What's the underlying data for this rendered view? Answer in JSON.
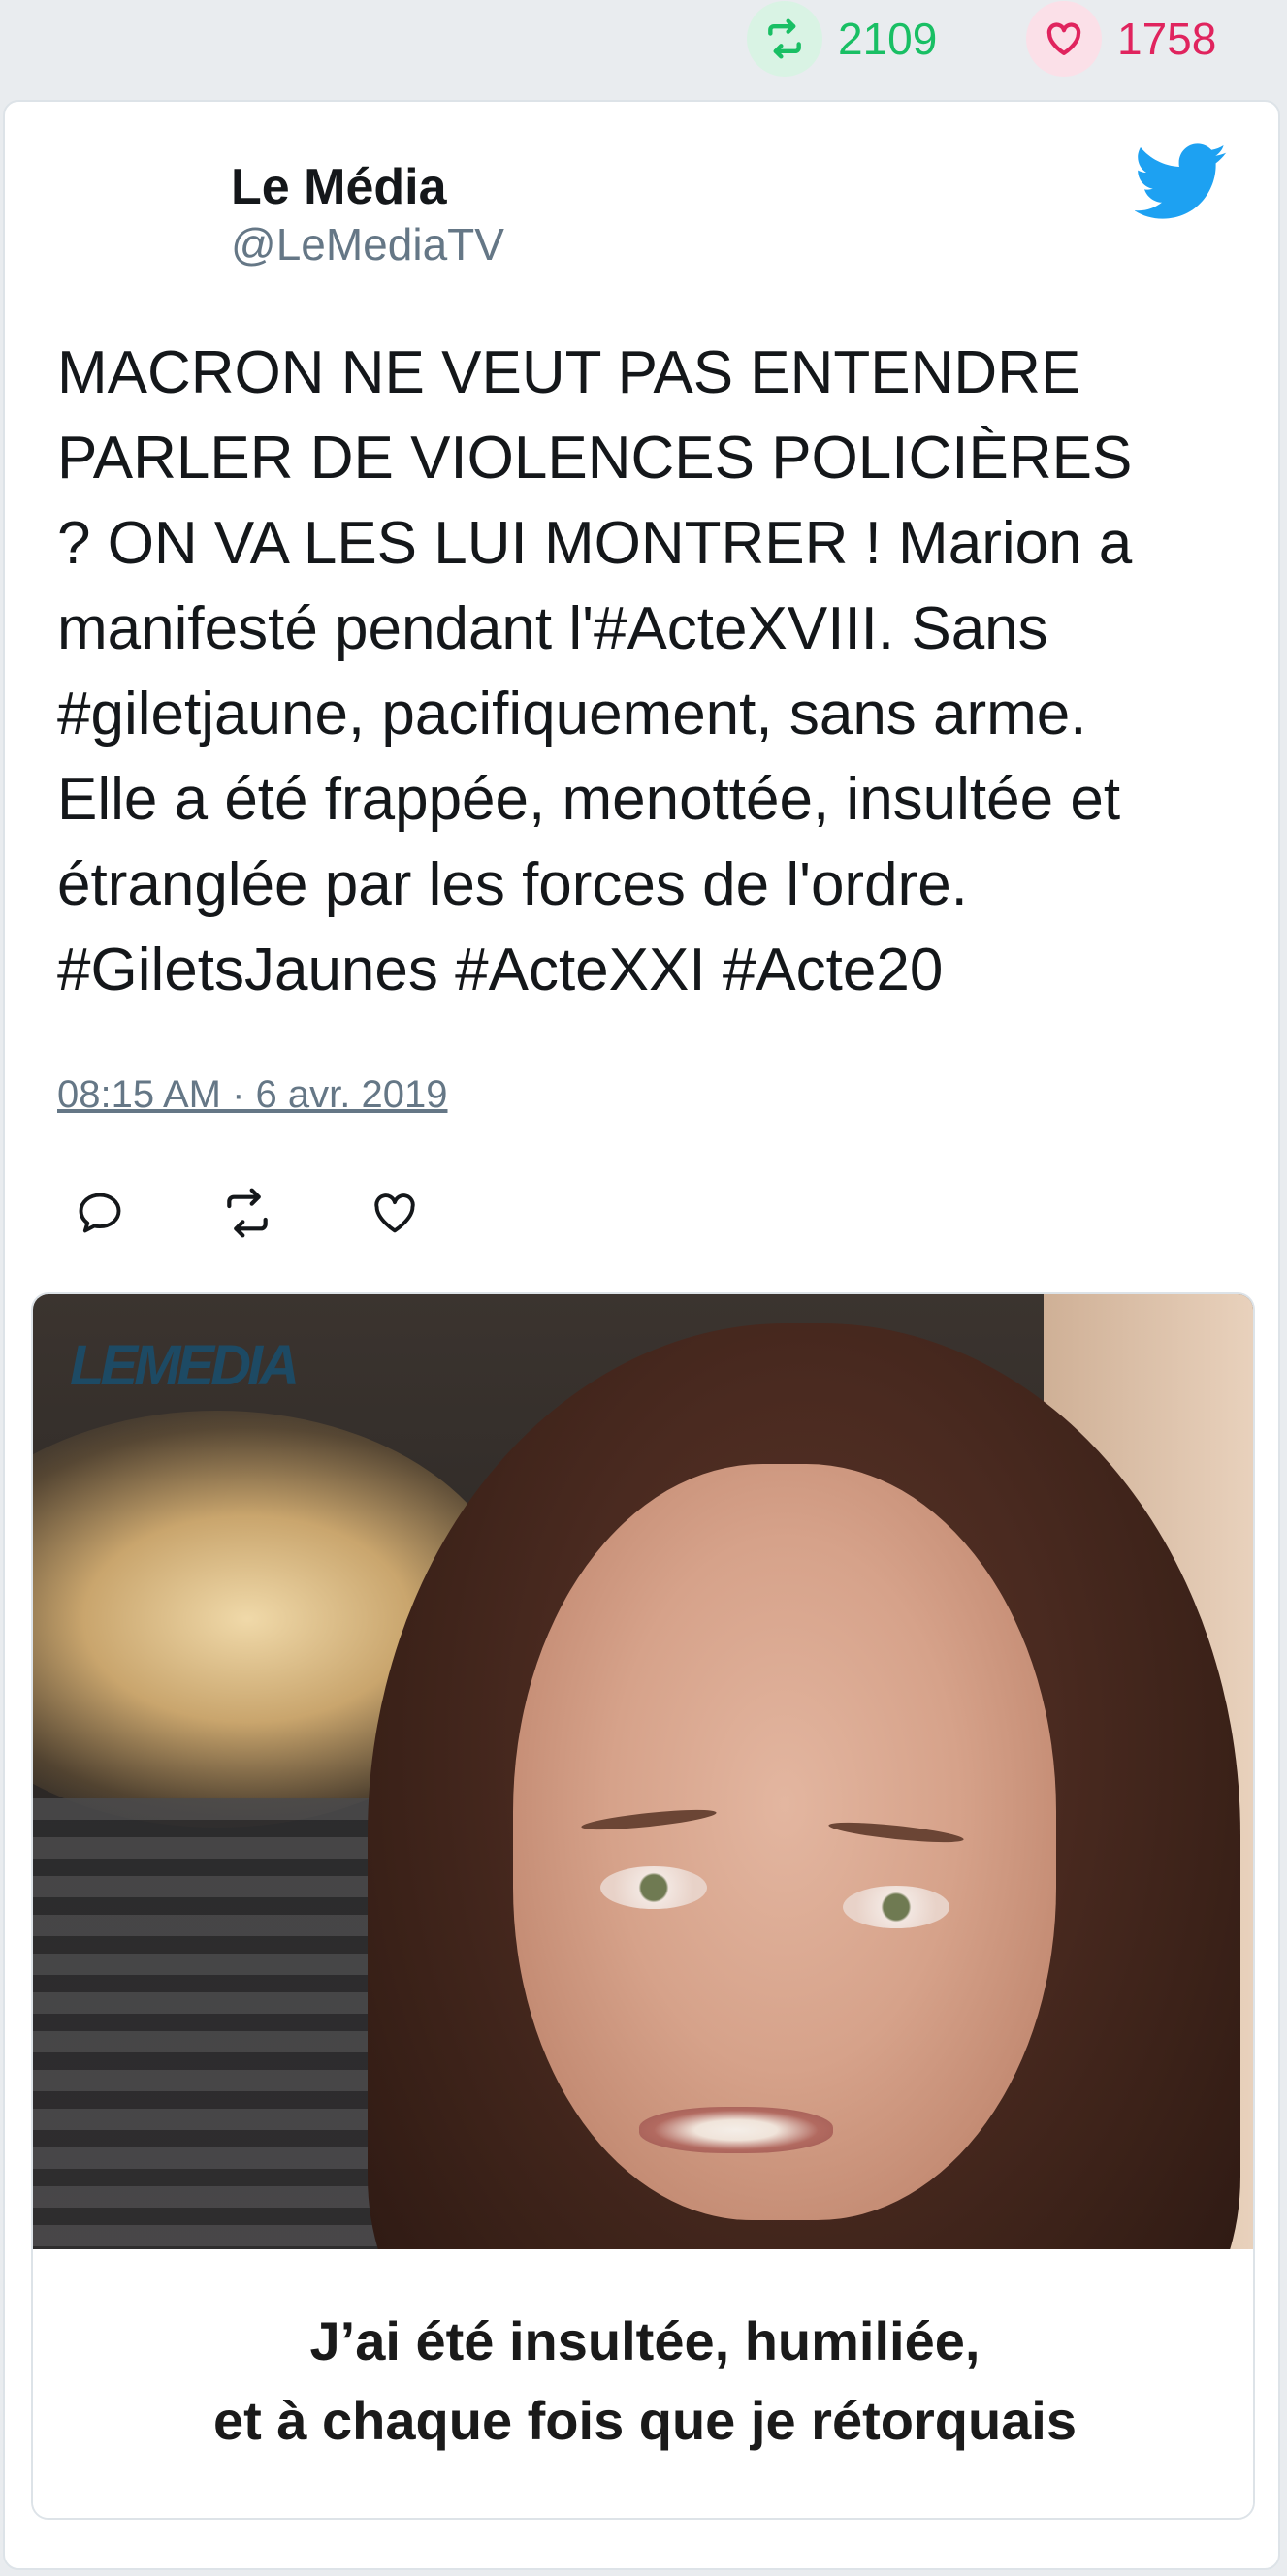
{
  "stats": {
    "retweets": "2109",
    "likes": "1758",
    "retweet_color": "#19bf64",
    "like_color": "#e0245e"
  },
  "tweet": {
    "author_name": "Le Média",
    "author_handle": "@LeMediaTV",
    "text": "MACRON NE VEUT PAS ENTENDRE\nPARLER DE VIOLENCES POLICIÈRES\n? ON VA LES LUI MONTRER ! Marion a\nmanifesté pendant l'#ActeXVIII. Sans\n#giletjaune, pacifiquement, sans arme.\nElle a été frappée, menottée, insultée et\nétranglée par les forces de l'ordre.\n#GiletsJaunes #ActeXXI #Acte20",
    "timestamp": "08:15 AM · 6 avr. 2019"
  },
  "icons": {
    "brand": "twitter-bird-icon",
    "brand_color": "#1da1f2",
    "reply": "reply-icon",
    "retweet": "retweet-icon",
    "like": "heart-icon"
  },
  "media": {
    "watermark": "LEMEDIA",
    "caption": "J’ai été insultée, humiliée,\net à chaque fois que je rétorquais"
  }
}
